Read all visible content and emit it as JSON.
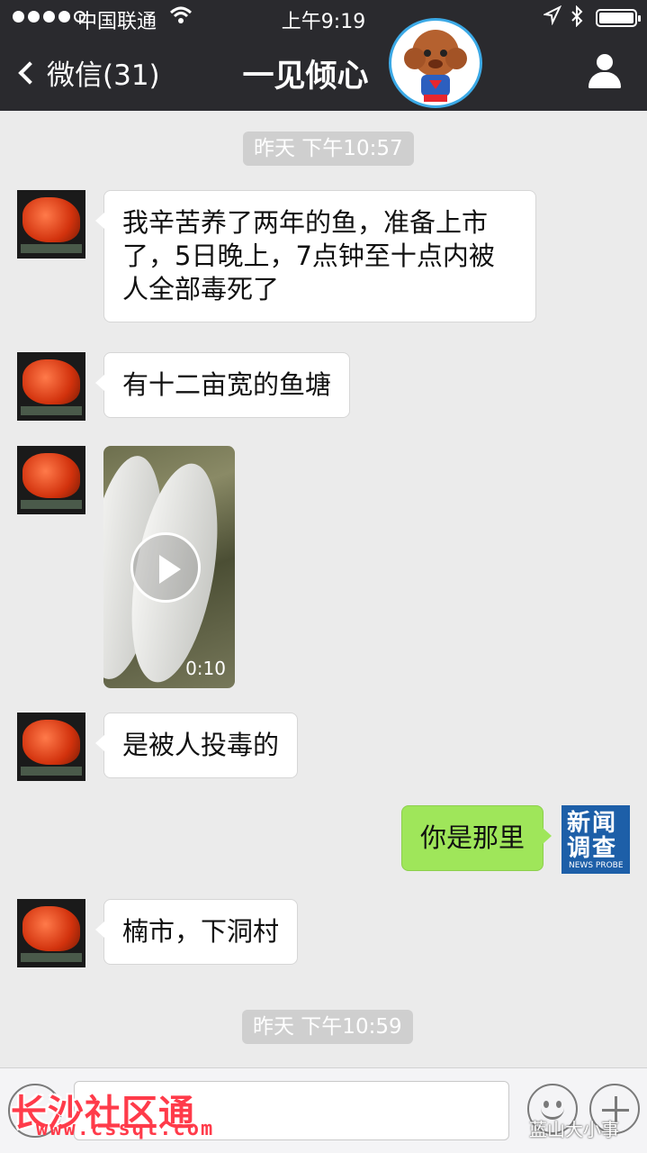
{
  "status_bar": {
    "carrier": "中国联通",
    "time": "上午9:19",
    "signal_bars_filled": 4,
    "signal_bars_total": 5
  },
  "nav": {
    "back_label": "微信(31)",
    "title": "一见倾心"
  },
  "messages": [
    {
      "type": "timestamp",
      "text": "昨天 下午10:57"
    },
    {
      "type": "text",
      "side": "left",
      "text": "我辛苦养了两年的鱼，准备上市了，5日晚上，7点钟至十点内被人全部毒死了"
    },
    {
      "type": "text",
      "side": "left",
      "text": "有十二亩宽的鱼塘"
    },
    {
      "type": "video",
      "side": "left",
      "duration": "0:10"
    },
    {
      "type": "text",
      "side": "left",
      "text": "是被人投毒的"
    },
    {
      "type": "text",
      "side": "right",
      "text": "你是那里",
      "avatar_text": "新闻调查",
      "avatar_sub": "NEWS PROBE"
    },
    {
      "type": "text",
      "side": "left",
      "text": "楠市，下洞村"
    },
    {
      "type": "timestamp",
      "text": "昨天 下午10:59"
    }
  ],
  "watermarks": {
    "site_name": "长沙社区通",
    "site_url": "www.cssqt.com",
    "account": "蓝山大小事"
  },
  "colors": {
    "nav_bg": "#2a2a2e",
    "chat_bg": "#ebebeb",
    "self_bubble": "#9fe65a",
    "other_bubble": "#ffffff"
  },
  "icons": [
    "back-chevron-icon",
    "wifi-icon",
    "location-arrow-icon",
    "bluetooth-icon",
    "battery-icon",
    "contact-profile-icon",
    "play-icon",
    "voice-icon",
    "emoji-icon",
    "plus-icon"
  ]
}
